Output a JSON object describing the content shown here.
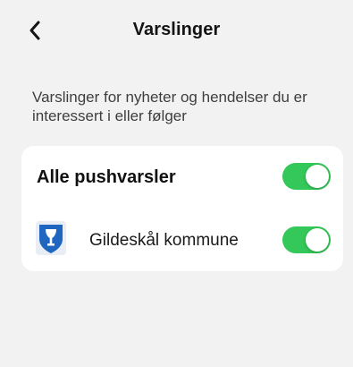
{
  "header": {
    "back_icon": "chevron-left-icon",
    "title": "Varslinger"
  },
  "description": "Varslinger for nyheter og hendelser du er interessert i eller følger",
  "settings": {
    "all_push": {
      "label": "Alle pushvarsler",
      "enabled": true
    },
    "items": [
      {
        "label": "Gildeskål kommune",
        "icon": "municipality-crest-icon",
        "enabled": true
      }
    ]
  },
  "colors": {
    "background": "#f2f2f2",
    "card": "#ffffff",
    "toggle_on": "#34c759",
    "crest_blue": "#1f66c1"
  }
}
